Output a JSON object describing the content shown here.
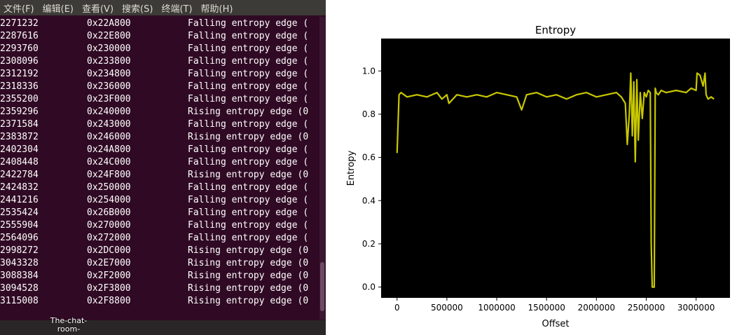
{
  "terminal": {
    "menu": [
      "文件(F)",
      "编辑(E)",
      "查看(V)",
      "搜索(S)",
      "终端(T)",
      "帮助(H)"
    ],
    "rows": [
      {
        "dec": "2271232",
        "hex": "0x22A800",
        "desc": "Falling entropy edge ("
      },
      {
        "dec": "2287616",
        "hex": "0x22E800",
        "desc": "Falling entropy edge ("
      },
      {
        "dec": "2293760",
        "hex": "0x230000",
        "desc": "Falling entropy edge ("
      },
      {
        "dec": "2308096",
        "hex": "0x233800",
        "desc": "Falling entropy edge ("
      },
      {
        "dec": "2312192",
        "hex": "0x234800",
        "desc": "Falling entropy edge ("
      },
      {
        "dec": "2318336",
        "hex": "0x236000",
        "desc": "Falling entropy edge ("
      },
      {
        "dec": "2355200",
        "hex": "0x23F000",
        "desc": "Falling entropy edge ("
      },
      {
        "dec": "2359296",
        "hex": "0x240000",
        "desc": "Rising entropy edge (0"
      },
      {
        "dec": "2371584",
        "hex": "0x243000",
        "desc": "Falling entropy edge ("
      },
      {
        "dec": "2383872",
        "hex": "0x246000",
        "desc": "Rising entropy edge (0"
      },
      {
        "dec": "2402304",
        "hex": "0x24A800",
        "desc": "Falling entropy edge ("
      },
      {
        "dec": "2408448",
        "hex": "0x24C000",
        "desc": "Falling entropy edge ("
      },
      {
        "dec": "2422784",
        "hex": "0x24F800",
        "desc": "Rising entropy edge (0"
      },
      {
        "dec": "2424832",
        "hex": "0x250000",
        "desc": "Falling entropy edge ("
      },
      {
        "dec": "2441216",
        "hex": "0x254000",
        "desc": "Falling entropy edge ("
      },
      {
        "dec": "2535424",
        "hex": "0x26B000",
        "desc": "Falling entropy edge ("
      },
      {
        "dec": "2555904",
        "hex": "0x270000",
        "desc": "Falling entropy edge ("
      },
      {
        "dec": "2564096",
        "hex": "0x272000",
        "desc": "Falling entropy edge ("
      },
      {
        "dec": "2998272",
        "hex": "0x2DC000",
        "desc": "Rising entropy edge (0"
      },
      {
        "dec": "3043328",
        "hex": "0x2E7000",
        "desc": "Rising entropy edge (0"
      },
      {
        "dec": "3088384",
        "hex": "0x2F2000",
        "desc": "Rising entropy edge (0"
      },
      {
        "dec": "3094528",
        "hex": "0x2F3800",
        "desc": "Rising entropy edge (0"
      },
      {
        "dec": "3115008",
        "hex": "0x2F8800",
        "desc": "Rising entropy edge (0"
      }
    ],
    "desktop_icon_label": "The-chat-room-"
  },
  "colors": {
    "terminal_bg": "#300a24",
    "terminal_text": "#ffffff",
    "plot_bg": "#000000",
    "line": "#c8c800"
  },
  "chart_data": {
    "type": "line",
    "title": "Entropy",
    "xlabel": "Offset",
    "ylabel": "Entropy",
    "xlim": [
      -160000,
      3340000
    ],
    "ylim": [
      -0.05,
      1.15
    ],
    "xticks": [
      0,
      500000,
      1000000,
      1500000,
      2000000,
      2500000,
      3000000
    ],
    "xtick_labels": [
      "0",
      "500000",
      "1000000",
      "1500000",
      "2000000",
      "2500000",
      "3000000"
    ],
    "yticks": [
      0.0,
      0.2,
      0.4,
      0.6,
      0.8,
      1.0
    ],
    "ytick_labels": [
      "0.0",
      "0.2",
      "0.4",
      "0.6",
      "0.8",
      "1.0"
    ],
    "grid": false,
    "series": [
      {
        "x": [
          0,
          20000,
          40000,
          100000,
          200000,
          300000,
          400000,
          450000,
          500000,
          520000,
          600000,
          700000,
          800000,
          900000,
          1000000,
          1100000,
          1200000,
          1250000,
          1300000,
          1400000,
          1500000,
          1600000,
          1700000,
          1800000,
          1900000,
          2000000,
          2100000,
          2200000,
          2250000,
          2290000,
          2310000,
          2330000,
          2345000,
          2360000,
          2375000,
          2390000,
          2405000,
          2420000,
          2440000,
          2460000,
          2480000,
          2500000,
          2520000,
          2540000,
          2550000,
          2560000,
          2570000,
          2580000,
          2590000,
          2600000,
          2620000,
          2650000,
          2700000,
          2800000,
          2900000,
          2950000,
          3000000,
          3010000,
          3040000,
          3070000,
          3090000,
          3100000,
          3120000,
          3150000,
          3180000
        ],
        "y": [
          0.62,
          0.89,
          0.9,
          0.88,
          0.89,
          0.88,
          0.9,
          0.87,
          0.89,
          0.85,
          0.89,
          0.88,
          0.89,
          0.88,
          0.9,
          0.89,
          0.88,
          0.82,
          0.89,
          0.9,
          0.88,
          0.89,
          0.87,
          0.89,
          0.9,
          0.88,
          0.89,
          0.9,
          0.88,
          0.85,
          0.66,
          0.8,
          0.99,
          0.7,
          0.95,
          0.58,
          0.96,
          0.68,
          0.9,
          0.78,
          0.9,
          0.88,
          0.91,
          0.9,
          0.2,
          0.0,
          0.0,
          0.0,
          0.92,
          0.9,
          0.89,
          0.91,
          0.9,
          0.91,
          0.9,
          0.92,
          0.91,
          0.99,
          0.98,
          0.93,
          0.99,
          0.89,
          0.87,
          0.88,
          0.87
        ]
      }
    ]
  }
}
